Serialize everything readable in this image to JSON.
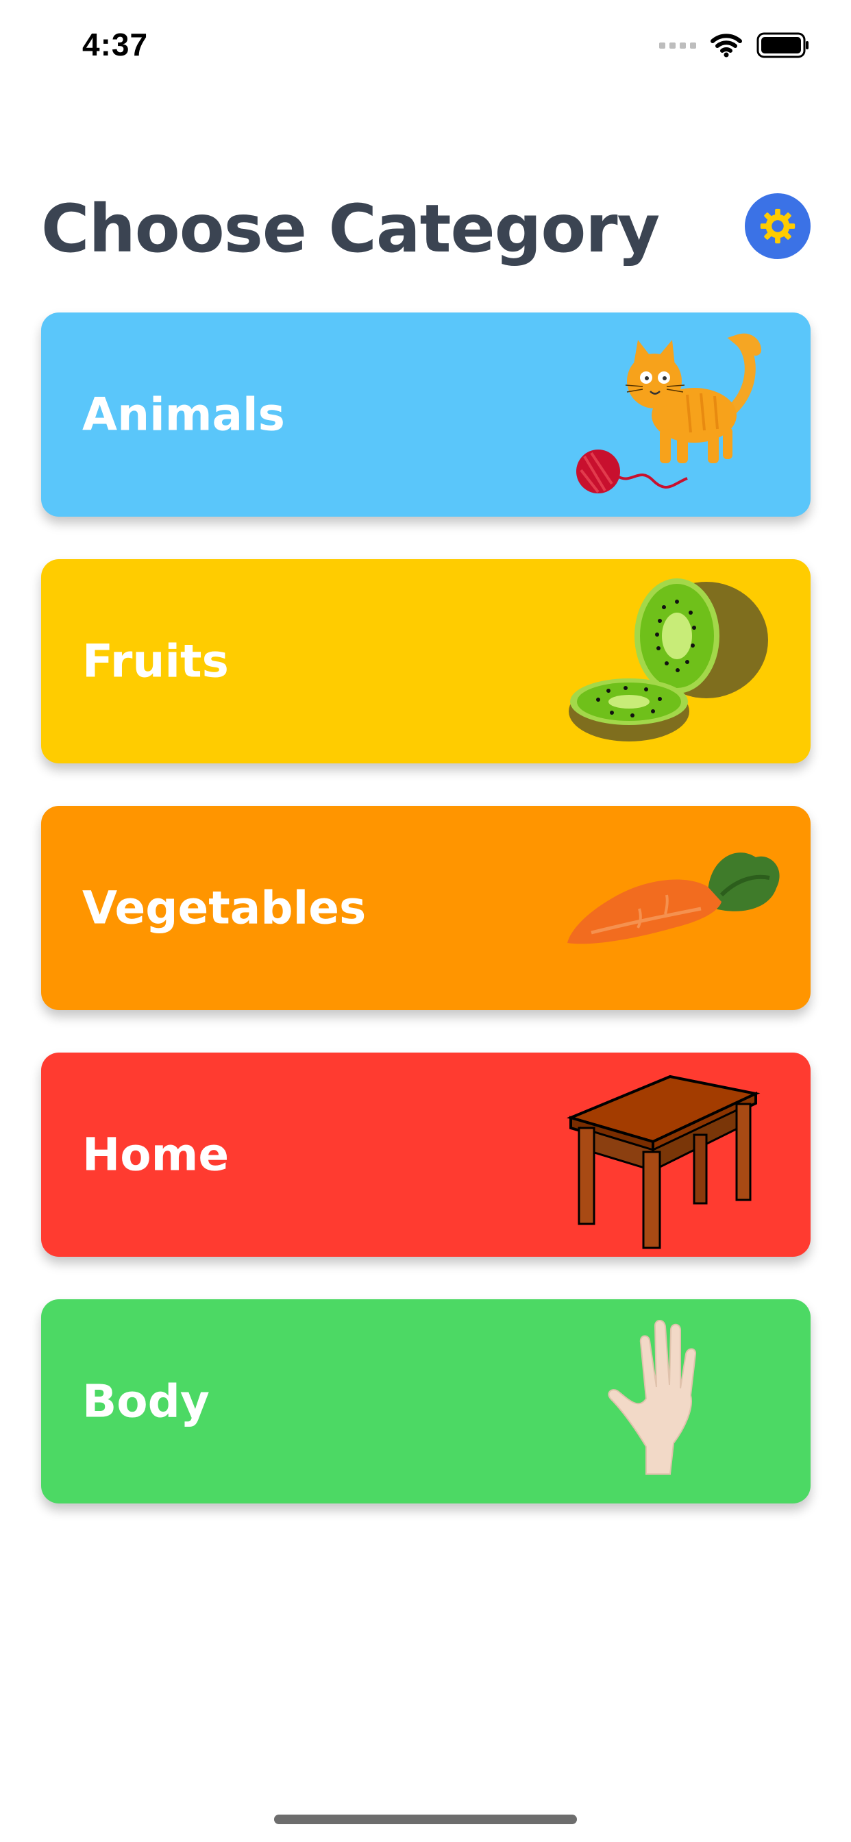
{
  "status_bar": {
    "time": "4:37"
  },
  "header": {
    "title": "Choose Category"
  },
  "categories": [
    {
      "label": "Animals",
      "color": "#5AC6FA"
    },
    {
      "label": "Fruits",
      "color": "#FFCC00"
    },
    {
      "label": "Vegetables",
      "color": "#FF9500"
    },
    {
      "label": "Home",
      "color": "#FF3B30"
    },
    {
      "label": "Body",
      "color": "#4CD964"
    }
  ],
  "icons": [
    "cellular-signal-icon",
    "wifi-icon",
    "battery-icon",
    "gear-icon",
    "cat-with-yarn-icon",
    "kiwi-icon",
    "carrot-icon",
    "table-icon",
    "hand-icon"
  ]
}
